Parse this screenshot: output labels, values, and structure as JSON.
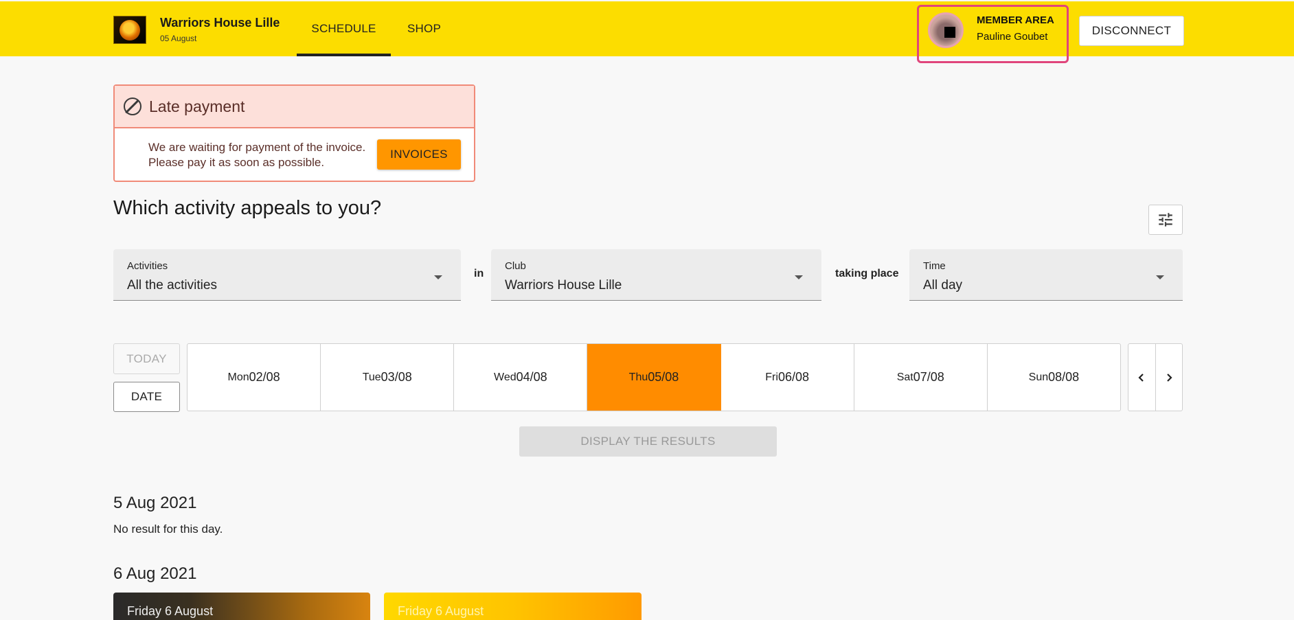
{
  "header": {
    "club_name": "Warriors House Lille",
    "date": "05 August",
    "nav": {
      "schedule": "SCHEDULE",
      "shop": "SHOP"
    },
    "member": {
      "title": "MEMBER AREA",
      "name": "Pauline Goubet"
    },
    "disconnect_label": "DISCONNECT",
    "accent_color": "#fcdd00"
  },
  "alert": {
    "title": "Late payment",
    "message_line1": "We are waiting for payment of the invoice.",
    "message_line2": "Please pay it as soon as possible.",
    "button_label": "INVOICES",
    "icon": "ban-icon"
  },
  "search": {
    "heading": "Which activity appeals to you?",
    "activities": {
      "label": "Activities",
      "value": "All the activities"
    },
    "connector_in": "in",
    "club": {
      "label": "Club",
      "value": "Warriors House Lille"
    },
    "connector_taking": "taking place",
    "time": {
      "label": "Time",
      "value": "All day"
    }
  },
  "dates": {
    "today_label": "TODAY",
    "date_label": "DATE",
    "days": [
      {
        "name": "Mon",
        "date": "02/08"
      },
      {
        "name": "Tue",
        "date": "03/08"
      },
      {
        "name": "Wed",
        "date": "04/08"
      },
      {
        "name": "Thu",
        "date": "05/08",
        "selected": true
      },
      {
        "name": "Fri",
        "date": "06/08"
      },
      {
        "name": "Sat",
        "date": "07/08"
      },
      {
        "name": "Sun",
        "date": "08/08"
      }
    ],
    "selected_color": "#ff8c00"
  },
  "display_label": "DISPLAY THE RESULTS",
  "results": [
    {
      "heading": "5 Aug 2021",
      "empty_text": "No result for this day."
    },
    {
      "heading": "6 Aug 2021",
      "cards": [
        {
          "title": "Friday 6 August"
        },
        {
          "title": "Friday 6 August"
        }
      ]
    }
  ]
}
